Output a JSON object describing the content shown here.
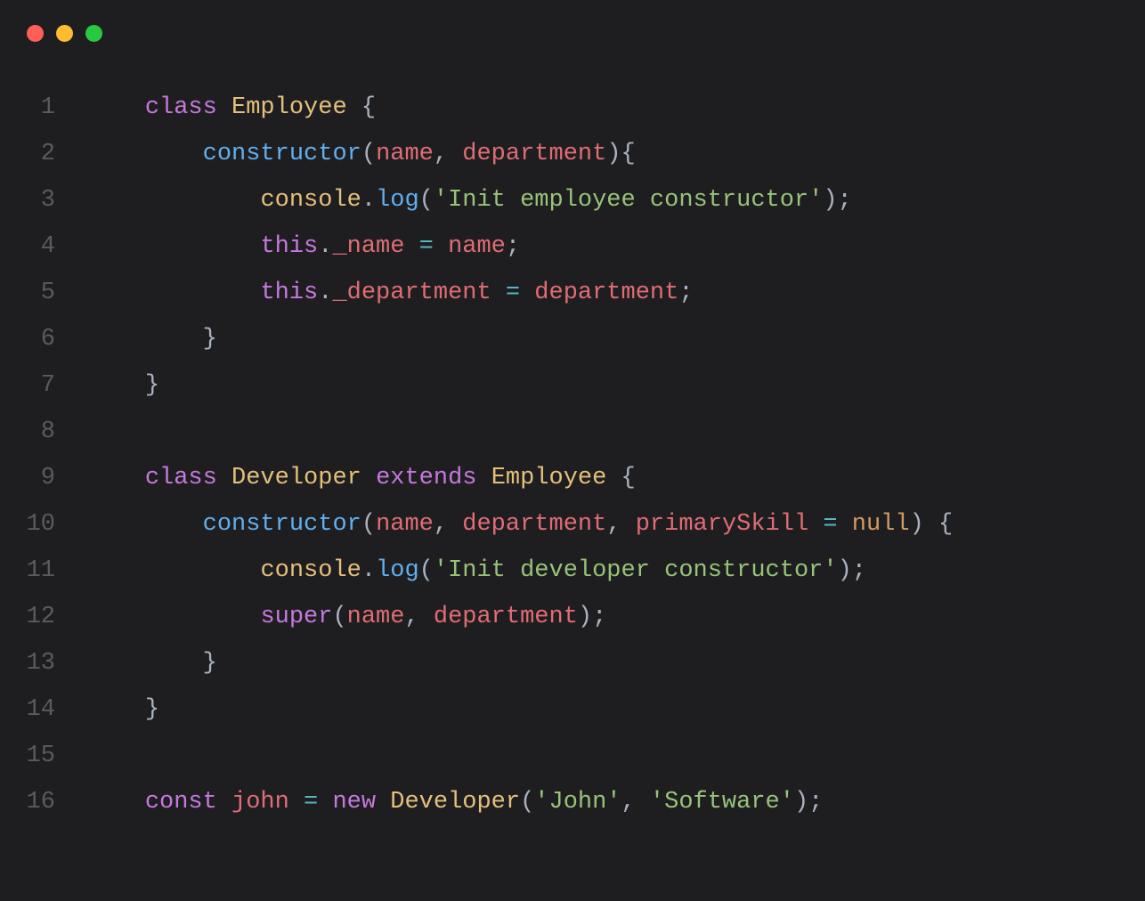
{
  "traffic_lights": {
    "red": "#ff5f57",
    "yellow": "#febc2e",
    "green": "#28c840"
  },
  "syntax_colors": {
    "keyword": "#c678dd",
    "class": "#e5c07b",
    "function": "#61afef",
    "param": "#e06c75",
    "object": "#e5c07b",
    "string": "#98c379",
    "operator": "#56b6c2",
    "literal": "#d19a66",
    "punct": "#abb2bf",
    "gutter": "#5a5a60",
    "bg": "#1e1e20"
  },
  "lines": [
    {
      "n": "1",
      "indent": "    ",
      "t": [
        [
          "kw",
          "class"
        ],
        [
          "punct",
          " "
        ],
        [
          "cls",
          "Employee"
        ],
        [
          "punct",
          " {"
        ]
      ]
    },
    {
      "n": "2",
      "indent": "        ",
      "t": [
        [
          "fn",
          "constructor"
        ],
        [
          "punct",
          "("
        ],
        [
          "param",
          "name"
        ],
        [
          "punct",
          ", "
        ],
        [
          "param",
          "department"
        ],
        [
          "punct",
          "){"
        ]
      ]
    },
    {
      "n": "3",
      "indent": "            ",
      "t": [
        [
          "obj",
          "console"
        ],
        [
          "punct",
          "."
        ],
        [
          "fn",
          "log"
        ],
        [
          "punct",
          "("
        ],
        [
          "str",
          "'Init employee constructor'"
        ],
        [
          "punct",
          ");"
        ]
      ]
    },
    {
      "n": "4",
      "indent": "            ",
      "t": [
        [
          "kw",
          "this"
        ],
        [
          "punct",
          "."
        ],
        [
          "prop",
          "_name"
        ],
        [
          "punct",
          " "
        ],
        [
          "op",
          "="
        ],
        [
          "punct",
          " "
        ],
        [
          "param",
          "name"
        ],
        [
          "punct",
          ";"
        ]
      ]
    },
    {
      "n": "5",
      "indent": "            ",
      "t": [
        [
          "kw",
          "this"
        ],
        [
          "punct",
          "."
        ],
        [
          "prop",
          "_department"
        ],
        [
          "punct",
          " "
        ],
        [
          "op",
          "="
        ],
        [
          "punct",
          " "
        ],
        [
          "param",
          "department"
        ],
        [
          "punct",
          ";"
        ]
      ]
    },
    {
      "n": "6",
      "indent": "        ",
      "t": [
        [
          "punct",
          "}"
        ]
      ]
    },
    {
      "n": "7",
      "indent": "    ",
      "t": [
        [
          "punct",
          "}"
        ]
      ]
    },
    {
      "n": "8",
      "indent": "",
      "t": []
    },
    {
      "n": "9",
      "indent": "    ",
      "t": [
        [
          "kw",
          "class"
        ],
        [
          "punct",
          " "
        ],
        [
          "cls",
          "Developer"
        ],
        [
          "punct",
          " "
        ],
        [
          "kw",
          "extends"
        ],
        [
          "punct",
          " "
        ],
        [
          "cls",
          "Employee"
        ],
        [
          "punct",
          " {"
        ]
      ]
    },
    {
      "n": "10",
      "indent": "        ",
      "t": [
        [
          "fn",
          "constructor"
        ],
        [
          "punct",
          "("
        ],
        [
          "param",
          "name"
        ],
        [
          "punct",
          ", "
        ],
        [
          "param",
          "department"
        ],
        [
          "punct",
          ", "
        ],
        [
          "param",
          "primarySkill"
        ],
        [
          "punct",
          " "
        ],
        [
          "op",
          "="
        ],
        [
          "punct",
          " "
        ],
        [
          "lit",
          "null"
        ],
        [
          "punct",
          ") {"
        ]
      ]
    },
    {
      "n": "11",
      "indent": "            ",
      "t": [
        [
          "obj",
          "console"
        ],
        [
          "punct",
          "."
        ],
        [
          "fn",
          "log"
        ],
        [
          "punct",
          "("
        ],
        [
          "str",
          "'Init developer constructor'"
        ],
        [
          "punct",
          ");"
        ]
      ]
    },
    {
      "n": "12",
      "indent": "            ",
      "t": [
        [
          "kw",
          "super"
        ],
        [
          "punct",
          "("
        ],
        [
          "param",
          "name"
        ],
        [
          "punct",
          ", "
        ],
        [
          "param",
          "department"
        ],
        [
          "punct",
          ");"
        ]
      ]
    },
    {
      "n": "13",
      "indent": "        ",
      "t": [
        [
          "punct",
          "}"
        ]
      ]
    },
    {
      "n": "14",
      "indent": "    ",
      "t": [
        [
          "punct",
          "}"
        ]
      ]
    },
    {
      "n": "15",
      "indent": "",
      "t": []
    },
    {
      "n": "16",
      "indent": "    ",
      "t": [
        [
          "kw",
          "const"
        ],
        [
          "punct",
          " "
        ],
        [
          "param",
          "john"
        ],
        [
          "punct",
          " "
        ],
        [
          "op",
          "="
        ],
        [
          "punct",
          " "
        ],
        [
          "kw",
          "new"
        ],
        [
          "punct",
          " "
        ],
        [
          "cls",
          "Developer"
        ],
        [
          "punct",
          "("
        ],
        [
          "str",
          "'John'"
        ],
        [
          "punct",
          ", "
        ],
        [
          "str",
          "'Software'"
        ],
        [
          "punct",
          ");"
        ]
      ]
    }
  ]
}
